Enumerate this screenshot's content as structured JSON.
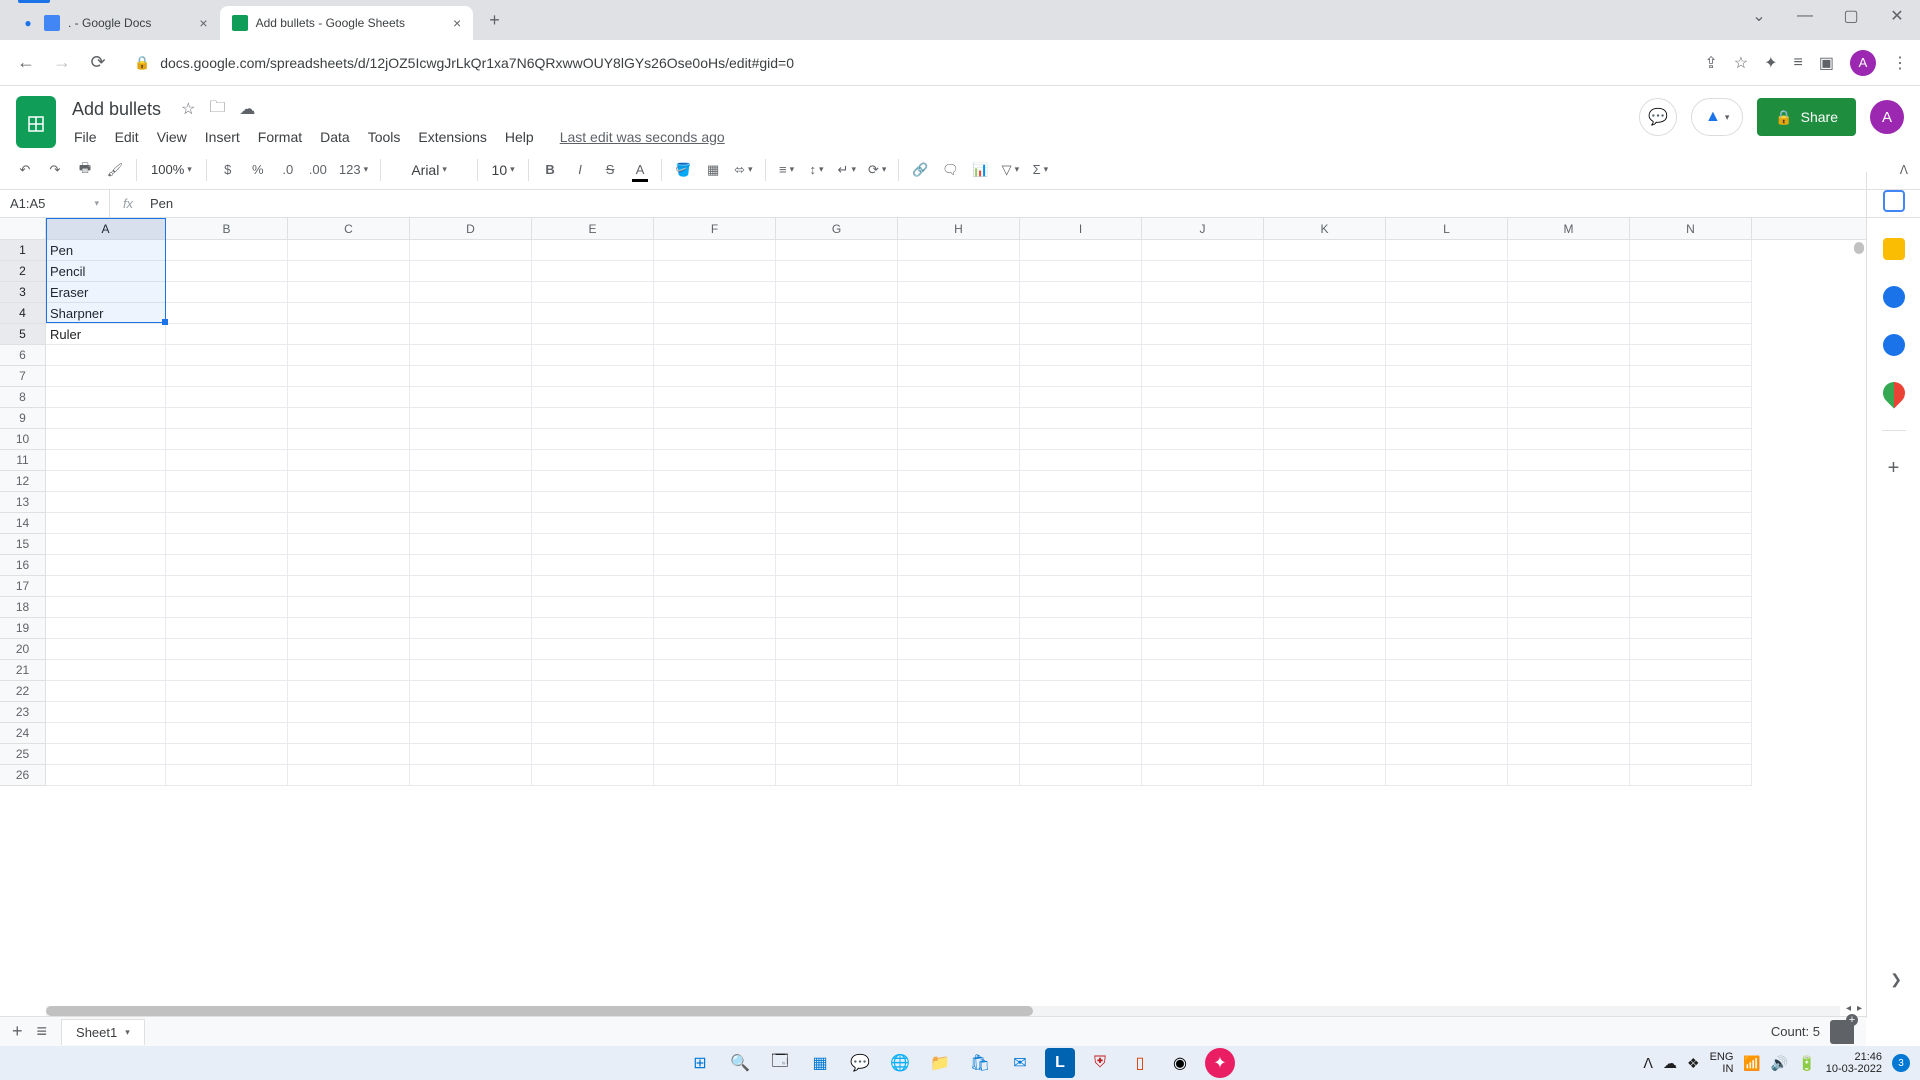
{
  "browser": {
    "tabs": [
      {
        "title": ". - Google Docs",
        "active": false
      },
      {
        "title": "Add bullets - Google Sheets",
        "active": true
      }
    ],
    "url": "docs.google.com/spreadsheets/d/12jOZ5IcwgJrLkQr1xa7N6QRxwwOUY8lGYs26Ose0oHs/edit#gid=0",
    "avatar_letter": "A"
  },
  "doc": {
    "title": "Add bullets",
    "last_edit": "Last edit was seconds ago",
    "share_label": "Share"
  },
  "menus": [
    "File",
    "Edit",
    "View",
    "Insert",
    "Format",
    "Data",
    "Tools",
    "Extensions",
    "Help"
  ],
  "toolbar": {
    "zoom": "100%",
    "format_num": "123",
    "font": "Arial",
    "font_size": "10"
  },
  "formula_bar": {
    "name_box": "A1:A5",
    "formula": "Pen"
  },
  "columns": [
    "A",
    "B",
    "C",
    "D",
    "E",
    "F",
    "G",
    "H",
    "I",
    "J",
    "K",
    "L",
    "M",
    "N"
  ],
  "row_count": 26,
  "cells": {
    "A1": "Pen",
    "A2": "Pencil",
    "A3": "Eraser",
    "A4": "Sharpner",
    "A5": "Ruler"
  },
  "selection": {
    "range": "A1:A5"
  },
  "sheet_tab": "Sheet1",
  "count_label": "Count: 5",
  "side_apps": [
    {
      "name": "calendar",
      "color": "#4285f4"
    },
    {
      "name": "keep",
      "color": "#fbbc04"
    },
    {
      "name": "tasks",
      "color": "#1a73e8"
    },
    {
      "name": "contacts",
      "color": "#1a73e8"
    },
    {
      "name": "maps",
      "color": "#34a853"
    }
  ],
  "tray": {
    "lang1": "ENG",
    "lang2": "IN",
    "time": "21:46",
    "date": "10-03-2022",
    "notif": "3"
  }
}
